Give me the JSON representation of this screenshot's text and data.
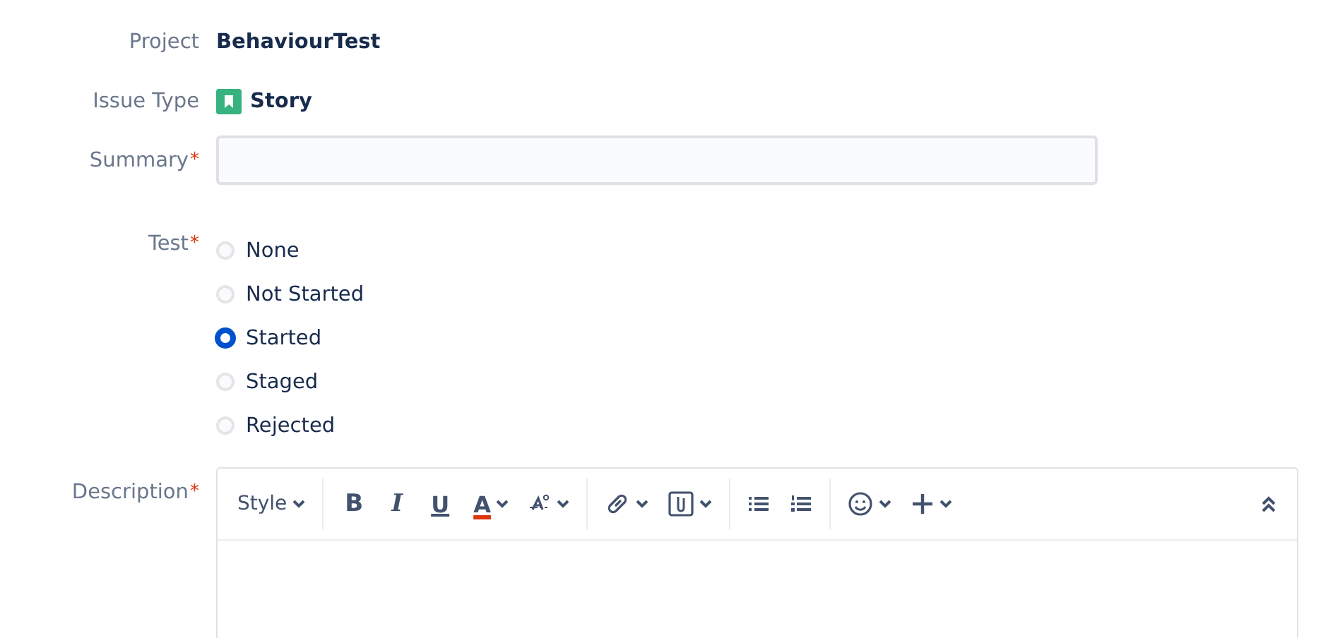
{
  "project": {
    "label": "Project",
    "value": "BehaviourTest"
  },
  "issue_type": {
    "label": "Issue Type",
    "value": "Story"
  },
  "summary": {
    "label": "Summary",
    "required_mark": "*"
  },
  "test": {
    "label": "Test",
    "required_mark": "*",
    "options": [
      {
        "label": "None",
        "selected": false
      },
      {
        "label": "Not Started",
        "selected": false
      },
      {
        "label": "Started",
        "selected": true
      },
      {
        "label": "Staged",
        "selected": false
      },
      {
        "label": "Rejected",
        "selected": false
      }
    ]
  },
  "description": {
    "label": "Description",
    "required_mark": "*",
    "toolbar": [
      {
        "kind": "style",
        "text": "Style"
      },
      {
        "kind": "sep"
      },
      {
        "kind": "bold",
        "text": "B"
      },
      {
        "kind": "italic",
        "text": "I"
      },
      {
        "kind": "underline",
        "text": "U"
      },
      {
        "kind": "color",
        "text": "A"
      },
      {
        "kind": "format"
      },
      {
        "kind": "sep"
      },
      {
        "kind": "link"
      },
      {
        "kind": "attach"
      },
      {
        "kind": "sep"
      },
      {
        "kind": "bullets"
      },
      {
        "kind": "numbers"
      },
      {
        "kind": "sep"
      },
      {
        "kind": "emoji"
      },
      {
        "kind": "plus"
      },
      {
        "kind": "spacer"
      },
      {
        "kind": "collapse"
      }
    ]
  }
}
